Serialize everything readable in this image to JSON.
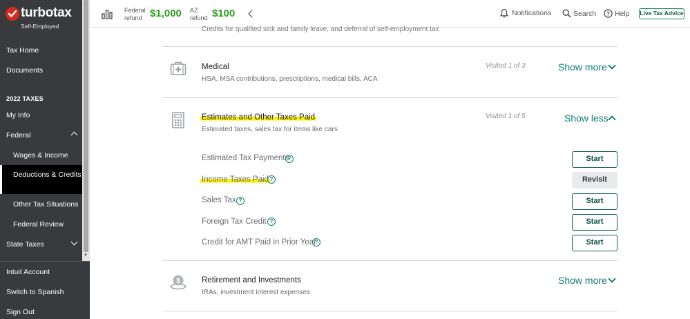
{
  "brand": {
    "name": "turbotax",
    "edition": "Self-Employed"
  },
  "sidebar": {
    "items": [
      {
        "label": "Tax Home"
      },
      {
        "label": "Documents"
      },
      {
        "label": "2022 TAXES"
      },
      {
        "label": "My Info"
      },
      {
        "label": "Federal"
      },
      {
        "label": "Wages & Income"
      },
      {
        "label": "Deductions & Credits"
      },
      {
        "label": "Other Tax Situations"
      },
      {
        "label": "Federal Review"
      },
      {
        "label": "State Taxes"
      }
    ],
    "bottom": [
      {
        "label": "Intuit Account"
      },
      {
        "label": "Switch to Spanish"
      },
      {
        "label": "Sign Out"
      }
    ]
  },
  "header": {
    "federal_label": "Federal refund",
    "federal_label_1": "Federal",
    "federal_label_2": "refund",
    "federal_amount": "$1,000",
    "az_label_1": "AZ",
    "az_label_2": "refund",
    "az_amount": "$100",
    "notifications": "Notifications",
    "search": "Search",
    "help": "Help",
    "live_advice": "Live Tax Advice"
  },
  "main": {
    "top_cut_text": "Credits for qualified sick and family leave, and deferral of self-employment tax",
    "categories": [
      {
        "title": "Medical",
        "desc": "HSA, MSA contributions, prescriptions, medical bills, ACA",
        "visited": "Visited 1 of 3",
        "toggle": "Show more",
        "icon": "medical-kit-icon"
      },
      {
        "title": "Estimates and Other Taxes Paid",
        "desc": "Estimated taxes, sales tax for items like cars",
        "visited": "Visited 1 of 5",
        "toggle": "Show less",
        "icon": "calculator-icon",
        "subitems": [
          {
            "label": "Estimated Tax Payments",
            "action": "Start"
          },
          {
            "label": "Income Taxes Paid",
            "action": "Revisit"
          },
          {
            "label": "Sales Tax",
            "action": "Start"
          },
          {
            "label": "Foreign Tax Credit",
            "action": "Start"
          },
          {
            "label": "Credit for AMT Paid in Prior Year",
            "action": "Start"
          }
        ]
      },
      {
        "title": "Retirement and Investments",
        "desc": "IRAs, investment interest expenses",
        "toggle": "Show more",
        "icon": "piggy-bank-icon"
      }
    ]
  },
  "colors": {
    "sidebar_bg": "#393a3d",
    "refund_green": "#2ca01c",
    "accent_teal": "#0d7e75",
    "highlight_yellow": "#fff200"
  }
}
